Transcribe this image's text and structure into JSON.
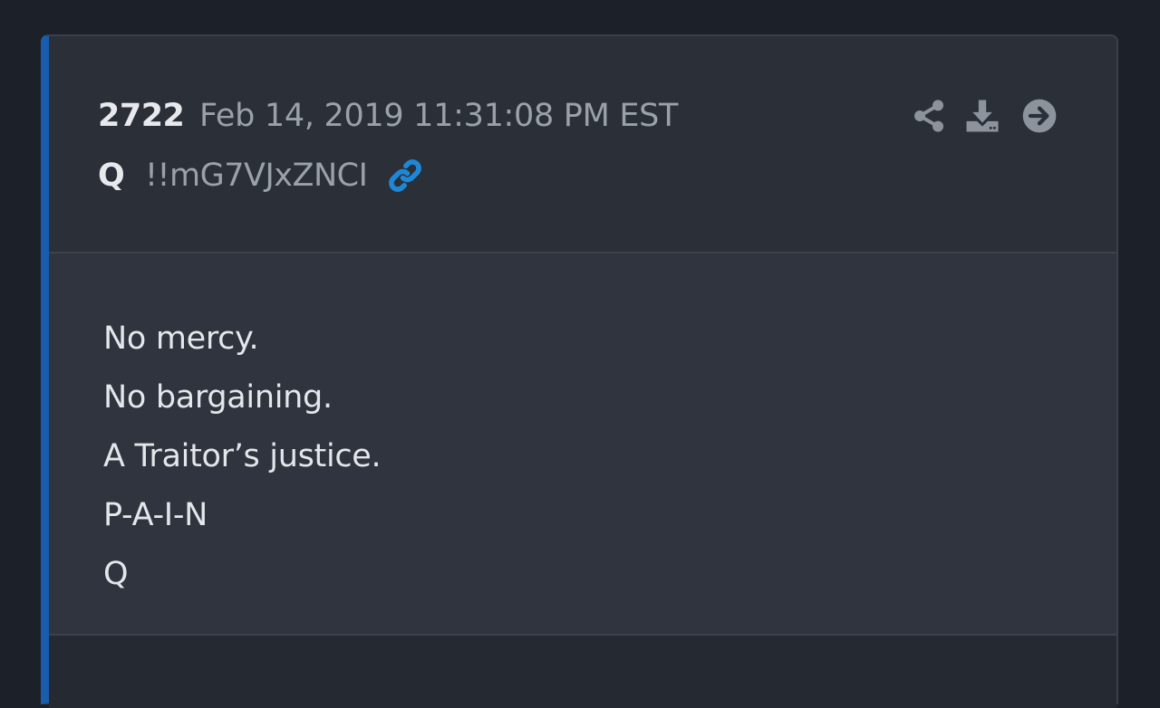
{
  "post": {
    "number": "2722",
    "timestamp": "Feb 14, 2019 11:31:08 PM EST",
    "author": "Q",
    "tripcode": "!!mG7VJxZNCI",
    "lines": [
      "No mercy.",
      "No bargaining.",
      "A Traitor’s justice.",
      "P-A-I-N",
      "Q"
    ]
  },
  "icons": {
    "permalink": "link-icon",
    "share": "share-icon",
    "download": "download-icon",
    "next": "arrow-right-circle-icon"
  },
  "colors": {
    "accent_border": "#1a5cad",
    "link_icon": "#1e88d6",
    "background": "#1c2028",
    "card": "#2a2f38",
    "body": "#2f343e"
  }
}
